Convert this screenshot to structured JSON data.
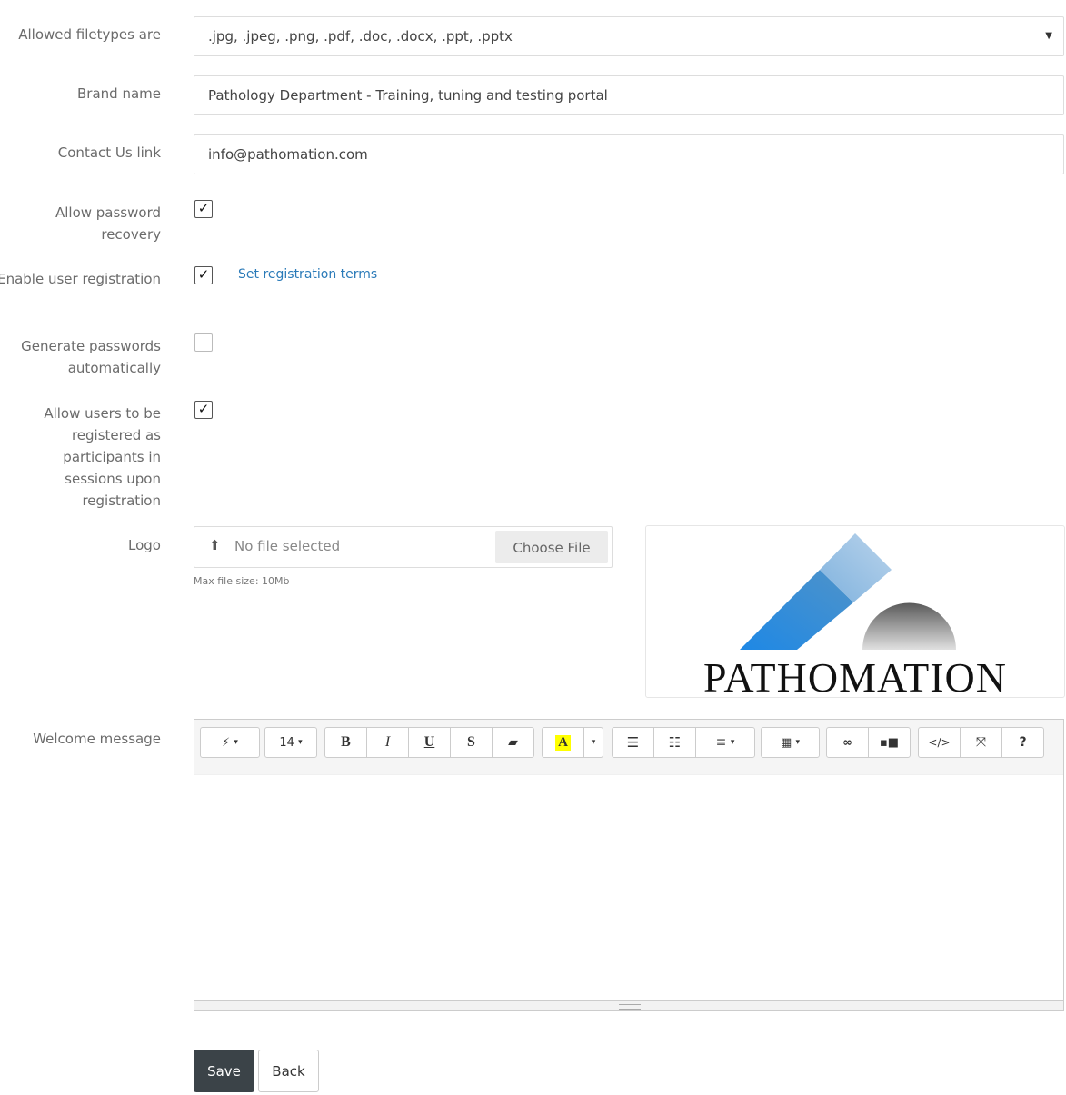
{
  "form": {
    "filetypes_label": "Allowed filetypes are",
    "filetypes_value": ".jpg, .jpeg, .png, .pdf, .doc, .docx, .ppt, .pptx",
    "brand_label": "Brand name",
    "brand_value": "Pathology Department - Training, tuning and testing portal",
    "contact_label": "Contact Us link",
    "contact_value": "info@pathomation.com",
    "pwd_recovery_label": "Allow password recovery",
    "pwd_recovery_checked": true,
    "user_reg_label": "Enable user registration",
    "user_reg_checked": true,
    "reg_terms_link": "Set registration terms",
    "gen_pwd_label": "Generate passwords automatically",
    "gen_pwd_checked": false,
    "participants_label": "Allow users to be registered as participants in sessions upon registration",
    "participants_checked": true,
    "logo_label": "Logo",
    "file_status": "No file selected",
    "choose_file": "Choose File",
    "max_size": "Max file size: 10Mb",
    "logo_text": "PATHOMATION",
    "welcome_label": "Welcome message"
  },
  "editor": {
    "font_size": "14",
    "tools": [
      "magic-wand",
      "font-size",
      "bold",
      "italic",
      "underline",
      "strikethrough",
      "eraser",
      "highlight",
      "bullet-list",
      "numbered-list",
      "align",
      "table",
      "link",
      "video",
      "code-view",
      "fullscreen",
      "help"
    ]
  },
  "actions": {
    "save": "Save",
    "back": "Back"
  },
  "colors": {
    "save_bg": "#3b4348",
    "link": "#2a7ab8",
    "highlight": "#ffff00",
    "logo_blue": "#2f8fd8",
    "logo_grey": "#8a8a8a"
  }
}
